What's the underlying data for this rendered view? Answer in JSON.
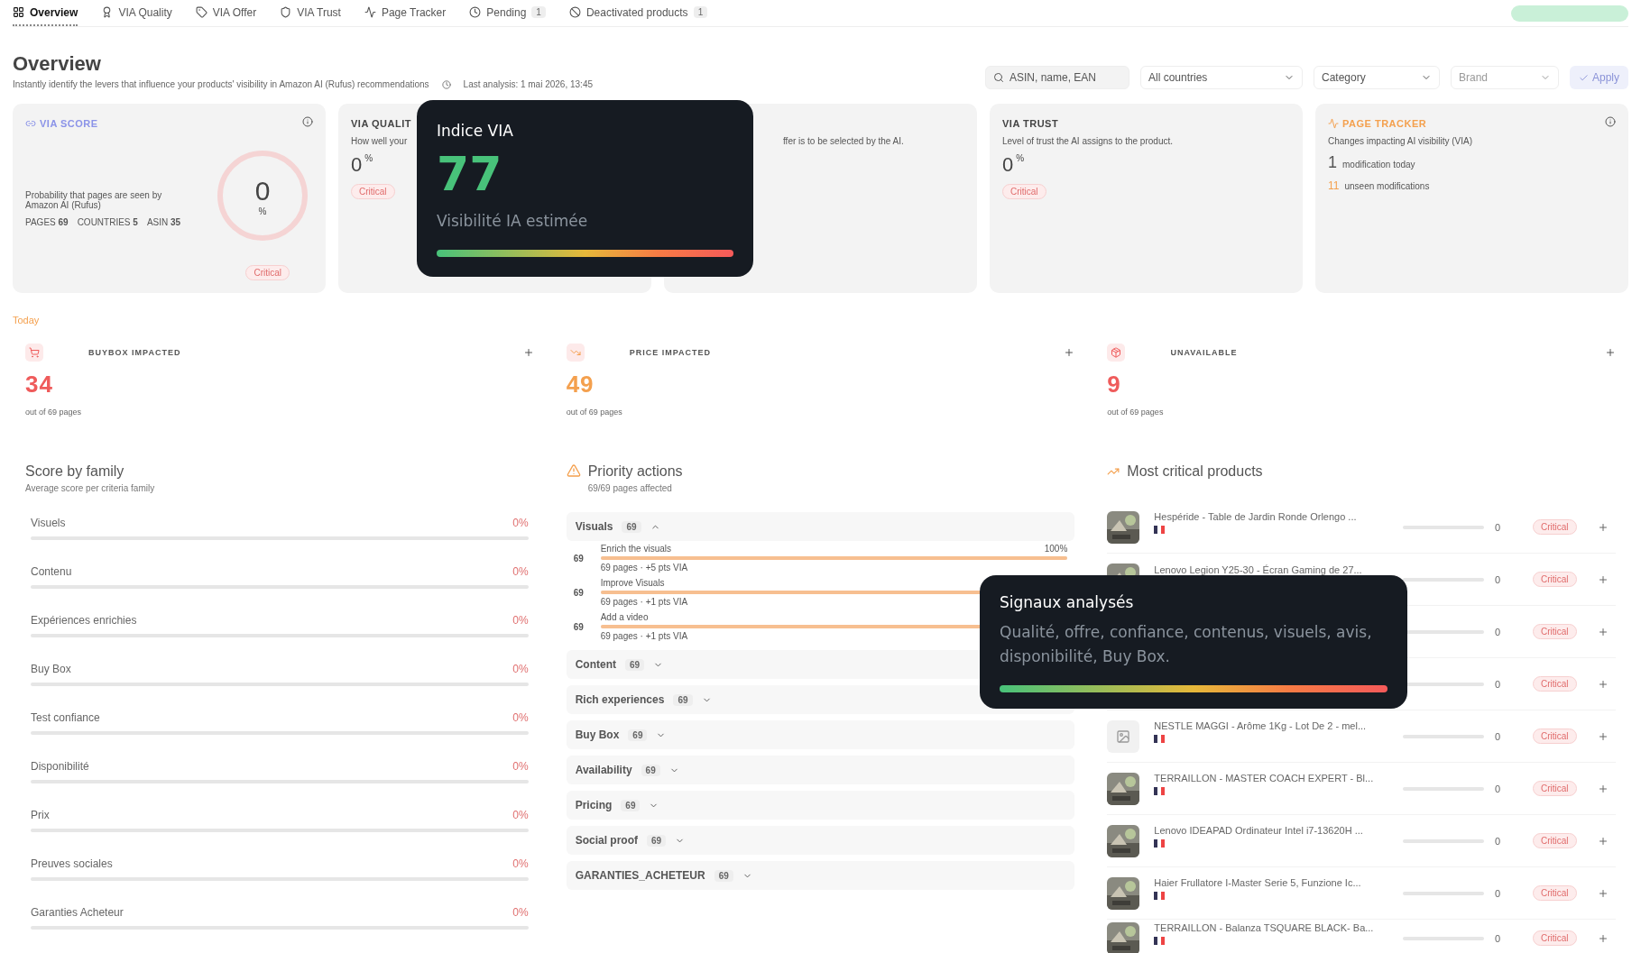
{
  "tabs": [
    {
      "label": "Overview",
      "selected": true
    },
    {
      "label": "VIA Quality",
      "selected": false
    },
    {
      "label": "VIA Offer",
      "selected": false
    },
    {
      "label": "VIA Trust",
      "selected": false
    },
    {
      "label": "Page Tracker",
      "selected": false
    },
    {
      "label": "Pending",
      "selected": false,
      "badge": "1"
    },
    {
      "label": "Deactivated products",
      "selected": false,
      "badge": "1"
    }
  ],
  "header": {
    "title": "Overview",
    "subtitle": "Instantly identify the levers that influence your products' visibility in Amazon AI (Rufus) recommendations",
    "last_analysis": "Last analysis: 1 mai 2026, 13:45"
  },
  "filters": {
    "search_placeholder": "ASIN, name, EAN",
    "country": "All countries",
    "category": "Category",
    "brand": "Brand",
    "apply": "Apply"
  },
  "score_card": {
    "title": "VIA SCORE",
    "description": "Probability that pages are seen by Amazon AI (Rufus)",
    "stats": [
      {
        "label": "PAGES",
        "value": "69"
      },
      {
        "label": "COUNTRIES",
        "value": "5"
      },
      {
        "label": "ASIN",
        "value": "35"
      }
    ],
    "score": "0",
    "unit": "%",
    "badge": "Critical"
  },
  "metric_cards": [
    {
      "title": "VIA QUALIT",
      "description": "How well your",
      "value": "0",
      "unit": "%",
      "badge": "Critical"
    },
    {
      "description": "ffer is to be selected by the AI."
    },
    {
      "title": "VIA TRUST",
      "description": "Level of trust the AI assigns to the product.",
      "value": "0",
      "unit": "%",
      "badge": "Critical"
    }
  ],
  "tracker_card": {
    "title": "PAGE TRACKER",
    "description": "Changes impacting AI visibility (VIA)",
    "today_count": "1",
    "today_label": "modification today",
    "unseen_count": "11",
    "unseen_label": "unseen modifications"
  },
  "today_label": "Today",
  "impacts": [
    {
      "title": "BUYBOX IMPACTED",
      "value": "34",
      "note": "out of 69 pages",
      "color": "#ef5b5b"
    },
    {
      "title": "PRICE IMPACTED",
      "value": "49",
      "note": "out of 69 pages",
      "color": "#f4a04e"
    },
    {
      "title": "UNAVAILABLE",
      "value": "9",
      "note": "out of 69 pages",
      "color": "#ef5b5b"
    }
  ],
  "families": {
    "title": "Score by family",
    "subtitle": "Average score per criteria family",
    "rows": [
      {
        "name": "Visuels",
        "value": "0%",
        "level": 0
      },
      {
        "name": "Contenu",
        "value": "0%",
        "level": 0
      },
      {
        "name": "Expériences enrichies",
        "value": "0%",
        "level": 0
      },
      {
        "name": "Buy Box",
        "value": "0%",
        "level": 0
      },
      {
        "name": "Test confiance",
        "value": "0%",
        "level": 0
      },
      {
        "name": "Disponibilité",
        "value": "0%",
        "level": 0
      },
      {
        "name": "Prix",
        "value": "0%",
        "level": 0
      },
      {
        "name": "Preuves sociales",
        "value": "0%",
        "level": 0
      },
      {
        "name": "Garanties Acheteur",
        "value": "0%",
        "level": 0
      }
    ]
  },
  "actions": {
    "title": "Priority actions",
    "subtitle": "69/69 pages affected",
    "groups": [
      {
        "name": "Visuals",
        "count": "69",
        "expanded": true,
        "items": [
          {
            "title": "Enrich the visuals",
            "count": "69",
            "detail": "69 pages · +5 pts VIA",
            "percent": "100%",
            "level": 1
          },
          {
            "title": "Improve Visuals",
            "count": "69",
            "detail": "69 pages · +1 pts VIA",
            "level": 1
          },
          {
            "title": "Add a video",
            "count": "69",
            "detail": "69 pages · +1 pts VIA",
            "level": 1
          }
        ]
      },
      {
        "name": "Content",
        "count": "69",
        "expanded": false
      },
      {
        "name": "Rich experiences",
        "count": "69",
        "expanded": false
      },
      {
        "name": "Buy Box",
        "count": "69",
        "expanded": false
      },
      {
        "name": "Availability",
        "count": "69",
        "expanded": false
      },
      {
        "name": "Pricing",
        "count": "69",
        "expanded": false
      },
      {
        "name": "Social proof",
        "count": "69",
        "expanded": false
      },
      {
        "name": "GARANTIES_ACHETEUR",
        "count": "69",
        "expanded": false
      }
    ]
  },
  "products": {
    "title": "Most critical products",
    "rows": [
      {
        "name": "Hespéride - Table de Jardin Ronde Orlengo ...",
        "score": "0",
        "badge": "Critical"
      },
      {
        "name": "Lenovo Legion Y25-30 - Écran Gaming de 27...",
        "score": "0",
        "badge": "Critical"
      },
      {
        "score": "0",
        "badge": "Critical"
      },
      {
        "score": "0",
        "badge": "Critical"
      },
      {
        "name": "NESTLE MAGGI - Arôme 1Kg - Lot De 2 - mel...",
        "score": "0",
        "badge": "Critical"
      },
      {
        "name": "TERRAILLON - MASTER COACH EXPERT - Bl...",
        "score": "0",
        "badge": "Critical"
      },
      {
        "name": "Lenovo IDEAPAD Ordinateur Intel i7-13620H ...",
        "score": "0",
        "badge": "Critical"
      },
      {
        "name": "Haier Frullatore I-Master Serie 5, Funzione Ic...",
        "score": "0",
        "badge": "Critical"
      },
      {
        "name": "TERRAILLON - Balanza TSQUARE BLACK- Ba...",
        "score": "0",
        "badge": "Critical"
      }
    ]
  },
  "tooltips": [
    {
      "title": "Indice VIA",
      "value": "77",
      "caption": "Visibilité IA estimée"
    },
    {
      "title": "Signaux analysés",
      "caption": "Qualité, offre, confiance, contenus, visuels, avis, disponibilité, Buy Box."
    }
  ]
}
